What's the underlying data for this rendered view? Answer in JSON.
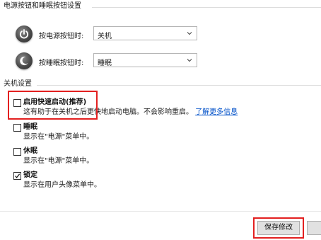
{
  "power_buttons_section": {
    "title": "电源按钮和睡眠按钮设置",
    "power_button": {
      "label": "按电源按钮时:",
      "value": "关机"
    },
    "sleep_button": {
      "label": "按睡眠按钮时:",
      "value": "睡眠"
    }
  },
  "shutdown_section": {
    "title": "关机设置",
    "items": [
      {
        "label": "启用快速启动(推荐)",
        "checked": false,
        "description": "这有助于在关机之后更快地启动电脑。不会影响重启。",
        "link": "了解更多信息"
      },
      {
        "label": "睡眠",
        "checked": false,
        "description": "显示在\"电源\"菜单中。"
      },
      {
        "label": "休眠",
        "checked": false,
        "description": "显示在\"电源\"菜单中。"
      },
      {
        "label": "锁定",
        "checked": true,
        "description": "显示在用户头像菜单中。"
      }
    ]
  },
  "footer": {
    "save_label": "保存修改"
  },
  "colors": {
    "highlight": "#e32020",
    "link": "#0050c8",
    "button_bg": "#e1e1e1"
  }
}
